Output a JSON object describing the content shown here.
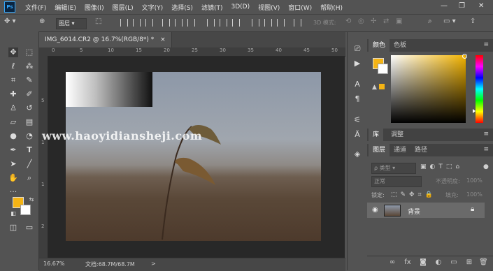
{
  "app": {
    "logo": "Ps"
  },
  "menu": [
    "文件(F)",
    "编辑(E)",
    "图像(I)",
    "图层(L)",
    "文字(Y)",
    "选择(S)",
    "滤镜(T)",
    "3D(D)",
    "视图(V)",
    "窗口(W)",
    "帮助(H)"
  ],
  "window_controls": {
    "minimize": "—",
    "maximize": "❐",
    "close": "✕"
  },
  "options": {
    "layer_select": "图层",
    "mode_3d": "3D 模式:"
  },
  "document": {
    "tab_label": "IMG_6014.CR2 @ 16.7%(RGB/8*) *",
    "tab_close": "×",
    "ruler_top_labels": [
      "0",
      "5",
      "10",
      "15",
      "20",
      "25",
      "30",
      "35",
      "40",
      "45",
      "50"
    ],
    "ruler_left_labels": [
      "5",
      "1",
      "1",
      "2"
    ],
    "watermark": "www.haoyidiansheji.com"
  },
  "status": {
    "zoom": "16.67%",
    "doc_size": "文档:68.7M/68.7M",
    "arrow": ">"
  },
  "panels": {
    "color_tabs": [
      "颜色",
      "色板"
    ],
    "lib_tabs": [
      "库",
      "调整"
    ],
    "layer_tabs": [
      "图层",
      "通道",
      "路径"
    ],
    "kind_filter": "ρ 类型",
    "blend_mode": "正常",
    "opacity_label": "不透明度:",
    "opacity_value": "100%",
    "lock_label": "锁定:",
    "fill_label": "填充:",
    "fill_value": "100%",
    "layer_name": "背景"
  },
  "colors": {
    "foreground": "#f5b414",
    "background": "#ffffff",
    "accent": "#31a8ff"
  },
  "icons": [
    "move-icon",
    "marquee-icon",
    "lasso-icon",
    "magic-wand-icon",
    "crop-icon",
    "eyedropper-icon",
    "healing-brush-icon",
    "brush-icon",
    "clone-stamp-icon",
    "history-brush-icon",
    "eraser-icon",
    "gradient-icon",
    "blur-icon",
    "dodge-icon",
    "pen-icon",
    "type-icon",
    "path-select-icon",
    "line-icon",
    "hand-icon",
    "zoom-icon",
    "more-tools-icon",
    "eye-icon",
    "lock-icon"
  ]
}
